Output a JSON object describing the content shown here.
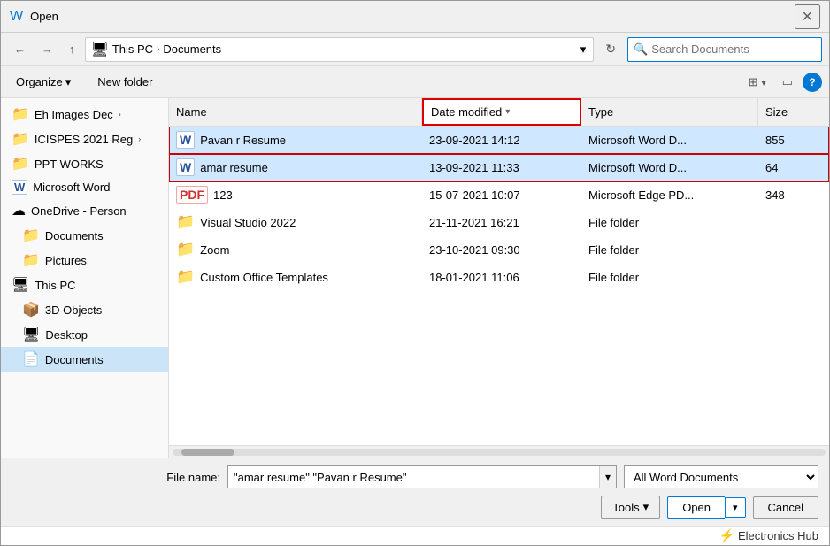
{
  "dialog": {
    "title": "Open",
    "close_label": "✕"
  },
  "toolbar": {
    "back_label": "←",
    "forward_label": "→",
    "up_label": "↑",
    "address": {
      "icon": "🖥",
      "segments": [
        "This PC",
        "Documents"
      ]
    },
    "refresh_label": "↻",
    "search_placeholder": "Search Documents"
  },
  "content_toolbar": {
    "organize_label": "Organize",
    "organize_arrow": "▾",
    "new_folder_label": "New folder",
    "view_icon1": "⊞",
    "view_arrow": "▾",
    "view_icon2": "▭",
    "help_label": "?"
  },
  "file_list": {
    "columns": [
      "Name",
      "Date modified",
      "Type",
      "Size"
    ],
    "rows": [
      {
        "name": "Pavan r Resume",
        "icon_type": "word",
        "icon_label": "W",
        "date": "23-09-2021 14:12",
        "type": "Microsoft Word D...",
        "size": "855",
        "selected": true
      },
      {
        "name": "amar resume",
        "icon_type": "word",
        "icon_label": "W",
        "date": "13-09-2021 11:33",
        "type": "Microsoft Word D...",
        "size": "64",
        "selected": true
      },
      {
        "name": "123",
        "icon_type": "pdf",
        "icon_label": "PDF",
        "date": "15-07-2021 10:07",
        "type": "Microsoft Edge PD...",
        "size": "348",
        "selected": false
      },
      {
        "name": "Visual Studio 2022",
        "icon_type": "folder",
        "date": "21-11-2021 16:21",
        "type": "File folder",
        "size": "",
        "selected": false
      },
      {
        "name": "Zoom",
        "icon_type": "folder",
        "date": "23-10-2021 09:30",
        "type": "File folder",
        "size": "",
        "selected": false
      },
      {
        "name": "Custom Office Templates",
        "icon_type": "folder",
        "date": "18-01-2021 11:06",
        "type": "File folder",
        "size": "",
        "selected": false
      }
    ]
  },
  "sidebar": {
    "items": [
      {
        "label": "Eh Images Dec",
        "icon": "📁",
        "indent": 1
      },
      {
        "label": "ICISPES 2021 Reg",
        "icon": "📁",
        "indent": 1
      },
      {
        "label": "PPT WORKS",
        "icon": "📁",
        "indent": 1
      },
      {
        "label": "Microsoft Word",
        "icon": "W",
        "indent": 0,
        "is_word": true
      },
      {
        "label": "OneDrive - Person",
        "icon": "☁",
        "indent": 0
      },
      {
        "label": "Documents",
        "icon": "📁",
        "indent": 1
      },
      {
        "label": "Pictures",
        "icon": "📁",
        "indent": 1
      },
      {
        "label": "This PC",
        "icon": "🖥",
        "indent": 0
      },
      {
        "label": "3D Objects",
        "icon": "📦",
        "indent": 1
      },
      {
        "label": "Desktop",
        "icon": "🖥",
        "indent": 1
      },
      {
        "label": "Documents",
        "icon": "📄",
        "indent": 1,
        "selected": true
      }
    ]
  },
  "bottom": {
    "filename_label": "File name:",
    "filename_value": "\"amar resume\" \"Pavan r Resume\"",
    "filetype_label": "All Word Documents",
    "tools_label": "Tools",
    "tools_arrow": "▾",
    "open_label": "Open",
    "open_arrow": "▾",
    "cancel_label": "Cancel"
  },
  "footer": {
    "brand_icon": "⚡",
    "brand_label": "Electronics Hub"
  }
}
